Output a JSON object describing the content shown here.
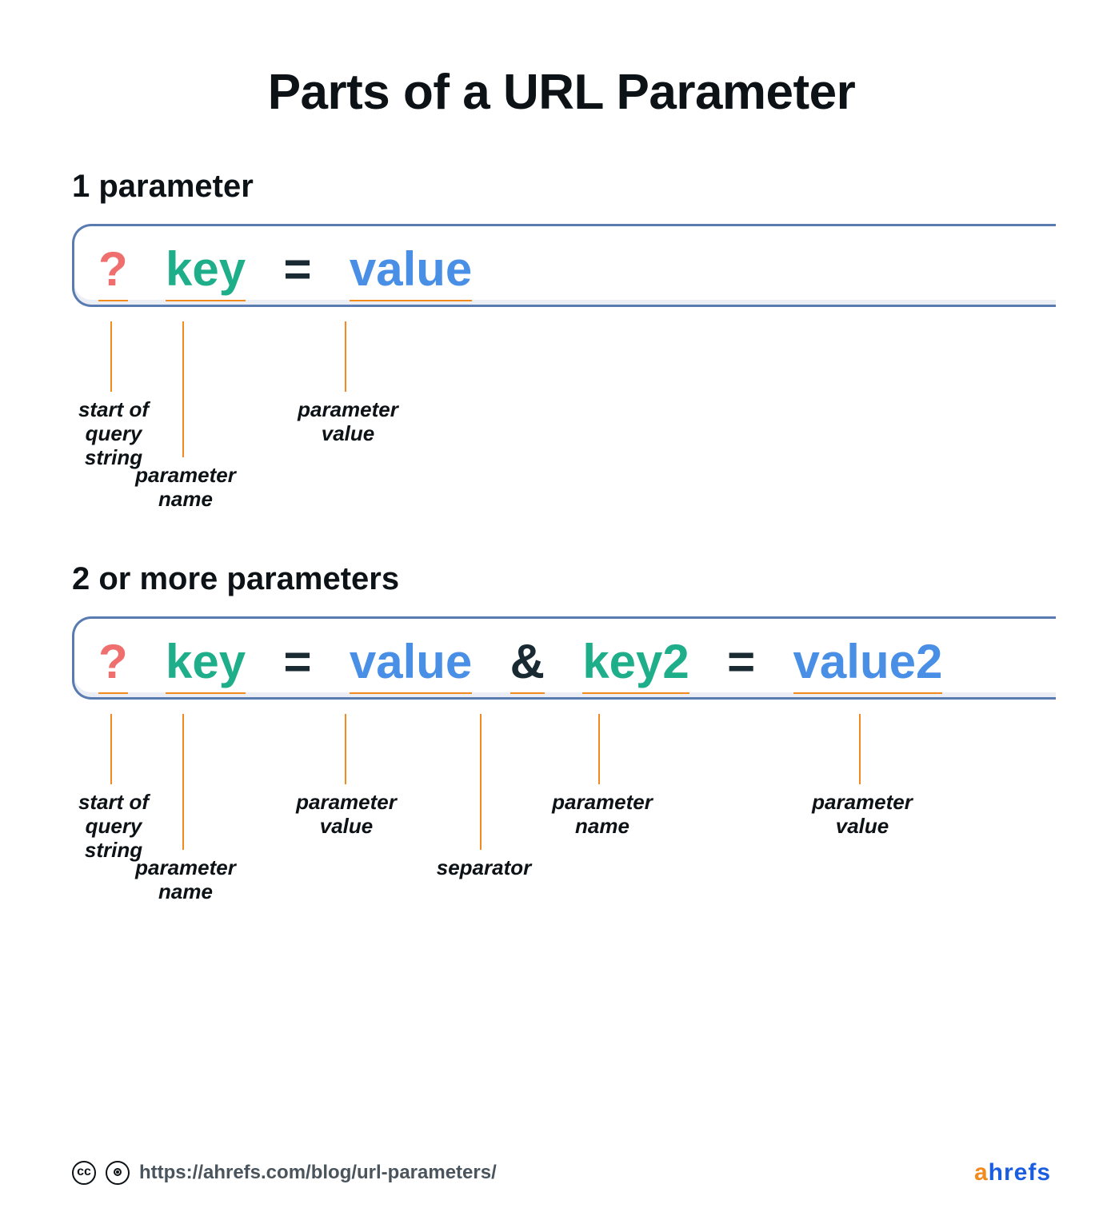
{
  "title": "Parts of a URL Parameter",
  "sections": {
    "one": {
      "heading": "1 parameter",
      "tokens": {
        "qm": "?",
        "key": "key",
        "eq": "=",
        "value": "value"
      },
      "labels": {
        "start": "start of\nquery\nstring",
        "pname": "parameter\nname",
        "pvalue": "parameter\nvalue"
      }
    },
    "two": {
      "heading": "2 or more parameters",
      "tokens": {
        "qm": "?",
        "key1": "key",
        "eq": "=",
        "value1": "value",
        "amp": "&",
        "key2": "key2",
        "value2": "value2"
      },
      "labels": {
        "start": "start of\nquery\nstring",
        "pname": "parameter\nname",
        "pvalue": "parameter\nvalue",
        "sep": "separator",
        "pname2": "parameter\nname",
        "pvalue2": "parameter\nvalue"
      }
    }
  },
  "footer": {
    "url": "https://ahrefs.com/blog/url-parameters/",
    "brand": {
      "a": "a",
      "hrefs": "hrefs"
    }
  },
  "colors": {
    "qm": "#ef6f6f",
    "key": "#1fae8a",
    "eq": "#1a2a33",
    "value": "#4a8fe6",
    "amp": "#1a2a33",
    "callout": "#f28a1e",
    "boxBorder": "#5a7bb0"
  }
}
